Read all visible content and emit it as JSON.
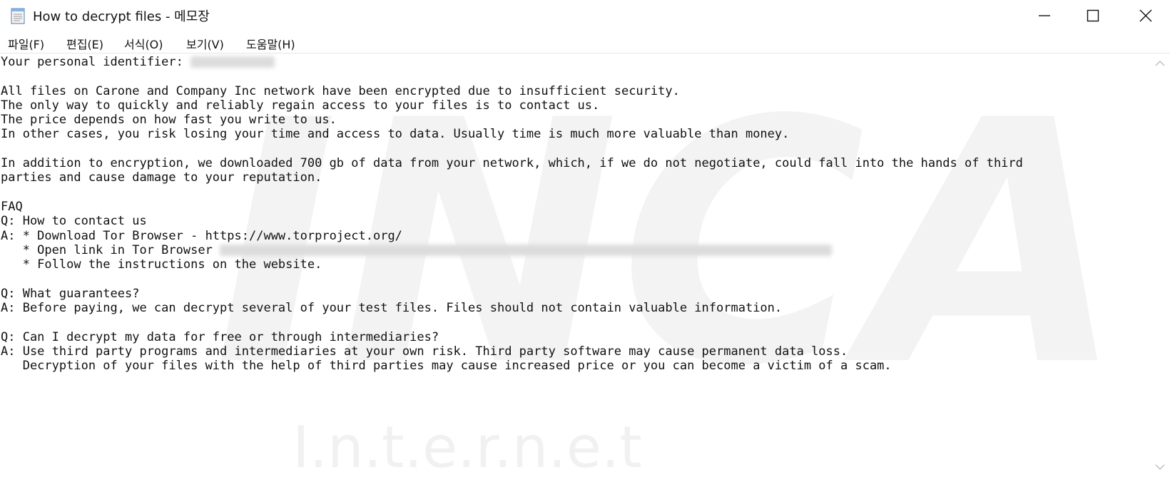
{
  "window": {
    "title": "How to decrypt files - 메모장",
    "app_icon": "notepad-icon",
    "controls": [
      "minimize-icon",
      "maximize-icon",
      "close-icon"
    ]
  },
  "menu": [
    "파일(F)",
    "편집(E)",
    "서식(O)",
    "보기(V)",
    "도움말(H)"
  ],
  "editor": {
    "lines": {
      "l1": "Your personal identifier: ",
      "l3": "All files on Carone and Company Inc network have been encrypted due to insufficient security.",
      "l4": "The only way to quickly and reliably regain access to your files is to contact us.",
      "l5": "The price depends on how fast you write to us.",
      "l6": "In other cases, you risk losing your time and access to data. Usually time is much more valuable than money.",
      "l8": "In addition to encryption, we downloaded 700 gb of data from your network, which, if we do not negotiate, could fall into the hands of third",
      "l9": "parties and cause damage to your reputation.",
      "l11": "FAQ",
      "l12": "Q: How to contact us",
      "l13": "A: * Download Tor Browser - https://www.torproject.org/",
      "l14": "   * Open link in Tor Browser ",
      "l15": "   * Follow the instructions on the website.",
      "l17": "Q: What guarantees?",
      "l18": "A: Before paying, we can decrypt several of your test files. Files should not contain valuable information.",
      "l20": "Q: Can I decrypt my data for free or through intermediaries?",
      "l21": "A: Use third party programs and intermediaries at your own risk. Third party software may cause permanent data loss.",
      "l22": "   Decryption of your files with the help of third parties may cause increased price or you can become a victim of a scam."
    }
  },
  "watermark": {
    "logo": "INCA",
    "caption": "I.n.t.e.r.n.e.t"
  },
  "colors": {
    "text": "#111111",
    "redaction": "#dcdcdc",
    "watermark": "#f3f3f3"
  }
}
